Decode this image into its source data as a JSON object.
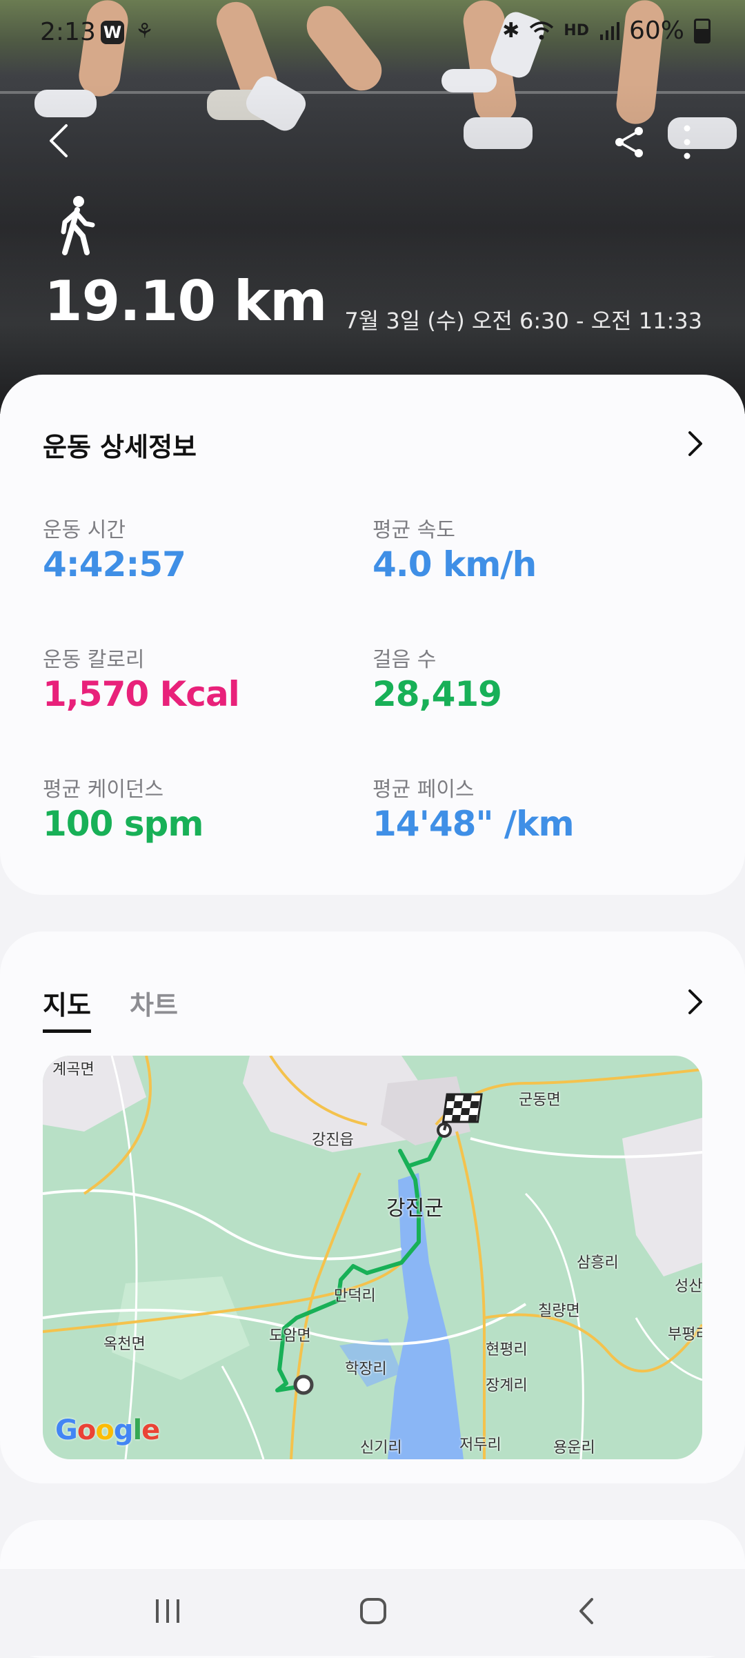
{
  "status_bar": {
    "time": "2:13",
    "app_badge": "W",
    "signal_text": "HD",
    "battery": "60%"
  },
  "workout": {
    "distance": "19.10 km",
    "date_range": "7월 3일 (수) 오전 6:30 - 오전 11:33"
  },
  "details": {
    "title": "운동 상세정보",
    "stats": [
      {
        "label": "운동 시간",
        "value": "4:42:57",
        "color": "#3f8fe6"
      },
      {
        "label": "평균 속도",
        "value": "4.0 km/h",
        "color": "#3f8fe6"
      },
      {
        "label": "운동 칼로리",
        "value": "1,570 Kcal",
        "color": "#e8217a"
      },
      {
        "label": "걸음 수",
        "value": "28,419",
        "color": "#18b057"
      },
      {
        "label": "평균 케이던스",
        "value": "100 spm",
        "color": "#18b057"
      },
      {
        "label": "평균 페이스",
        "value": "14'48\" /km",
        "color": "#3f8fe6"
      }
    ]
  },
  "map_section": {
    "tabs": [
      {
        "label": "지도",
        "selected": true
      },
      {
        "label": "차트",
        "selected": false
      }
    ],
    "places": [
      "계곡면",
      "강진읍",
      "군동면",
      "강진군",
      "삼흥리",
      "성산",
      "만덕리",
      "칠량면",
      "부평리",
      "옥천면",
      "도암면",
      "현평리",
      "학장리",
      "장계리",
      "신기리",
      "저두리",
      "용운리"
    ],
    "logo": "Google",
    "route_color": "#18b057"
  },
  "icons": {
    "back": "chevron-left-icon",
    "share": "share-icon",
    "more": "more-vertical-icon",
    "activity": "walking-person-icon",
    "finish": "checkered-flag-icon",
    "start": "start-marker-icon"
  }
}
